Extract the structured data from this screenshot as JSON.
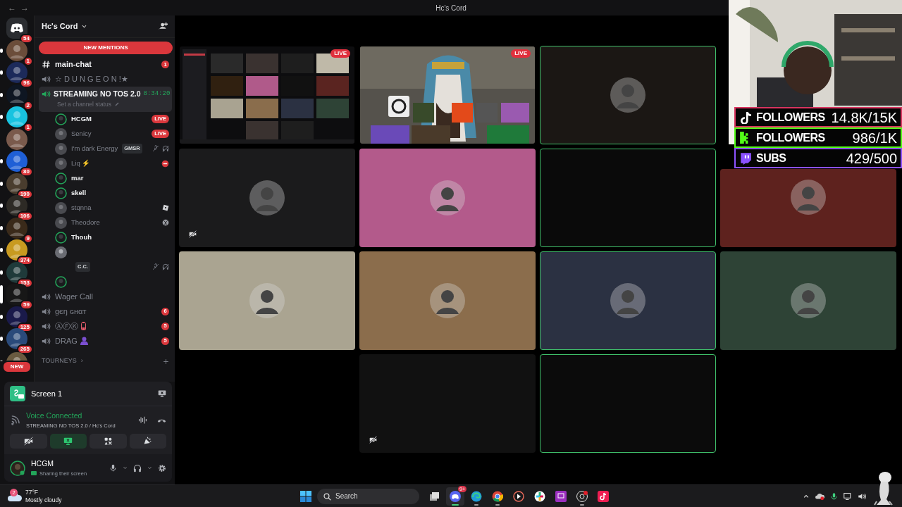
{
  "window": {
    "nav": [
      "←",
      "→"
    ],
    "title": "Hc's Cord"
  },
  "servers": [
    {
      "kind": "home",
      "badge": "54",
      "unread": false,
      "selected": false
    },
    {
      "kind": "server",
      "badge": "1",
      "unread": true,
      "selected": false
    },
    {
      "kind": "server",
      "badge": "96",
      "unread": true,
      "selected": false
    },
    {
      "kind": "server",
      "badge": "2",
      "unread": true,
      "selected": false
    },
    {
      "kind": "server",
      "badge": "1",
      "unread": true,
      "selected": false
    },
    {
      "kind": "server",
      "unread": false,
      "selected": false
    },
    {
      "kind": "server",
      "badge": "80",
      "unread": true,
      "selected": false
    },
    {
      "kind": "server",
      "badge": "190",
      "unread": true,
      "selected": false
    },
    {
      "kind": "server",
      "badge": "106",
      "unread": true,
      "selected": false
    },
    {
      "kind": "server",
      "badge": "9",
      "unread": true,
      "selected": false
    },
    {
      "kind": "server",
      "badge": "374",
      "unread": true,
      "selected": false
    },
    {
      "kind": "server",
      "badge": "153",
      "unread": true,
      "selected": false
    },
    {
      "kind": "server",
      "badge": "59",
      "selected": true
    },
    {
      "kind": "server",
      "badge": "125",
      "unread": true,
      "selected": false
    },
    {
      "kind": "server",
      "badge": "265",
      "unread": true,
      "selected": false
    },
    {
      "kind": "new",
      "badge": "NEW",
      "unread": true,
      "selected": false
    }
  ],
  "server_header": {
    "name": "Hc's Cord",
    "mentions": "NEW MENTIONS"
  },
  "channels": [
    {
      "kind": "text",
      "name": "main-chat",
      "badge": "1"
    },
    {
      "kind": "voice",
      "name": "☆ D U N G E O N !★"
    },
    {
      "kind": "live-voice",
      "name": "STREAMING NO TOS 2.0",
      "timer": "8:34:20",
      "status": "Set a channel status",
      "members": [
        {
          "kind": "plain",
          "name": "HCGM",
          "speaking": true,
          "dim": false,
          "badge": "LIVE"
        },
        {
          "kind": "plain",
          "name": "Senicy",
          "speaking": false,
          "dim": true,
          "badge": "LIVE"
        },
        {
          "kind": "deafened",
          "name": "I'm dark Energy",
          "speaking": false,
          "dim": true,
          "tag": "GMSR"
        },
        {
          "kind": "dnd",
          "name": "Liq ⚡",
          "speaking": false,
          "dim": true
        },
        {
          "kind": "plain",
          "name": "mar",
          "speaking": true,
          "dim": false
        },
        {
          "kind": "plain",
          "name": "skell",
          "speaking": true,
          "dim": false
        },
        {
          "kind": "roblox",
          "name": "stqnna",
          "speaking": false,
          "dim": true
        },
        {
          "kind": "xbox",
          "name": "Theodore",
          "speaking": false,
          "dim": true
        },
        {
          "kind": "plain",
          "name": "Thouh",
          "speaking": true,
          "dim": false
        },
        {
          "kind": "deafened",
          "speaking": false,
          "tag": "C.C."
        },
        {
          "kind": "plain",
          "speaking": true
        }
      ]
    },
    {
      "kind": "voice",
      "name": "Wager Call"
    },
    {
      "kind": "voice",
      "name": "gєŋ ɢнαт",
      "badge": "6"
    },
    {
      "kind": "voice",
      "name": "ⒶⒻⓀ",
      "badge": "5"
    },
    {
      "kind": "voice",
      "name": "DRAG",
      "badge": "5"
    },
    {
      "kind": "category",
      "name": "TOURNEYS",
      "chevron": "›"
    }
  ],
  "voice_panel": {
    "stream": "Screen 1",
    "state": "Voice Connected",
    "location": "STREAMING NO TOS 2.0 / Hc's Cord",
    "controls": [
      {
        "kind": "camera",
        "active": false
      },
      {
        "kind": "screen",
        "active": true
      },
      {
        "kind": "activities",
        "active": false
      },
      {
        "kind": "soundboard",
        "active": false
      }
    ],
    "user": {
      "name": "HCGM",
      "status": "Sharing their screen"
    }
  },
  "tiles": [
    {
      "kind": "screen",
      "badge": "LIVE",
      "speaking": false,
      "muted": false
    },
    {
      "kind": "game",
      "badge": "LIVE",
      "speaking": false,
      "muted": false
    },
    {
      "kind": "avatar",
      "color": "#1b1714",
      "speaking": true,
      "muted": false
    },
    {
      "kind": "avatar",
      "color": "#1b1b1c",
      "speaking": false,
      "muted": true
    },
    {
      "kind": "avatar",
      "color": "#b35a8b",
      "speaking": false,
      "muted": false
    },
    {
      "kind": "empty",
      "color": "#0a0a0a",
      "speaking": true,
      "muted": false
    },
    {
      "kind": "avatar",
      "color": "#5e221e",
      "speaking": false,
      "muted": false
    },
    {
      "kind": "avatar",
      "color": "#aaa491",
      "speaking": false,
      "muted": false
    },
    {
      "kind": "avatar",
      "color": "#8b6d4c",
      "speaking": false,
      "muted": false
    },
    {
      "kind": "avatar",
      "color": "#2b3142",
      "speaking": true,
      "muted": false
    },
    {
      "kind": "avatar",
      "color": "#2e4336",
      "speaking": false,
      "muted": false
    },
    {
      "kind": "empty",
      "color": "#111111",
      "speaking": false,
      "muted": true
    },
    {
      "kind": "empty",
      "color": "#0b0b0b",
      "speaking": true,
      "muted": false
    }
  ],
  "stream_overlay": {
    "kind": "picture",
    "stats": [
      {
        "kind": "tiktok",
        "label": "FOLLOWERS",
        "value": "14.8K/15K",
        "color": "#d9345f"
      },
      {
        "kind": "kick",
        "label": "FOLLOWERS",
        "value": "986/1K",
        "color": "#53fc18"
      },
      {
        "kind": "twitch",
        "label": "SUBS",
        "value": "429/500",
        "color": "#8c52ff"
      }
    ]
  },
  "taskbar": {
    "weather": {
      "badge": "2",
      "temperature": "77°F",
      "condition": "Mostly cloudy"
    },
    "search": {
      "placeholder": "Search"
    },
    "apps": [
      {
        "kind": "taskview",
        "running": false,
        "selected": false
      },
      {
        "kind": "discord",
        "badge": "9+",
        "running": true,
        "selected": true
      },
      {
        "kind": "edge",
        "running": true,
        "selected": false
      },
      {
        "kind": "chrome",
        "running": true,
        "selected": false
      },
      {
        "kind": "player",
        "running": false,
        "selected": false
      },
      {
        "kind": "slack",
        "running": false,
        "selected": false
      },
      {
        "kind": "purple",
        "running": false,
        "selected": false
      },
      {
        "kind": "obs",
        "running": true,
        "selected": false
      },
      {
        "kind": "tiktok",
        "running": false,
        "selected": false
      }
    ]
  }
}
